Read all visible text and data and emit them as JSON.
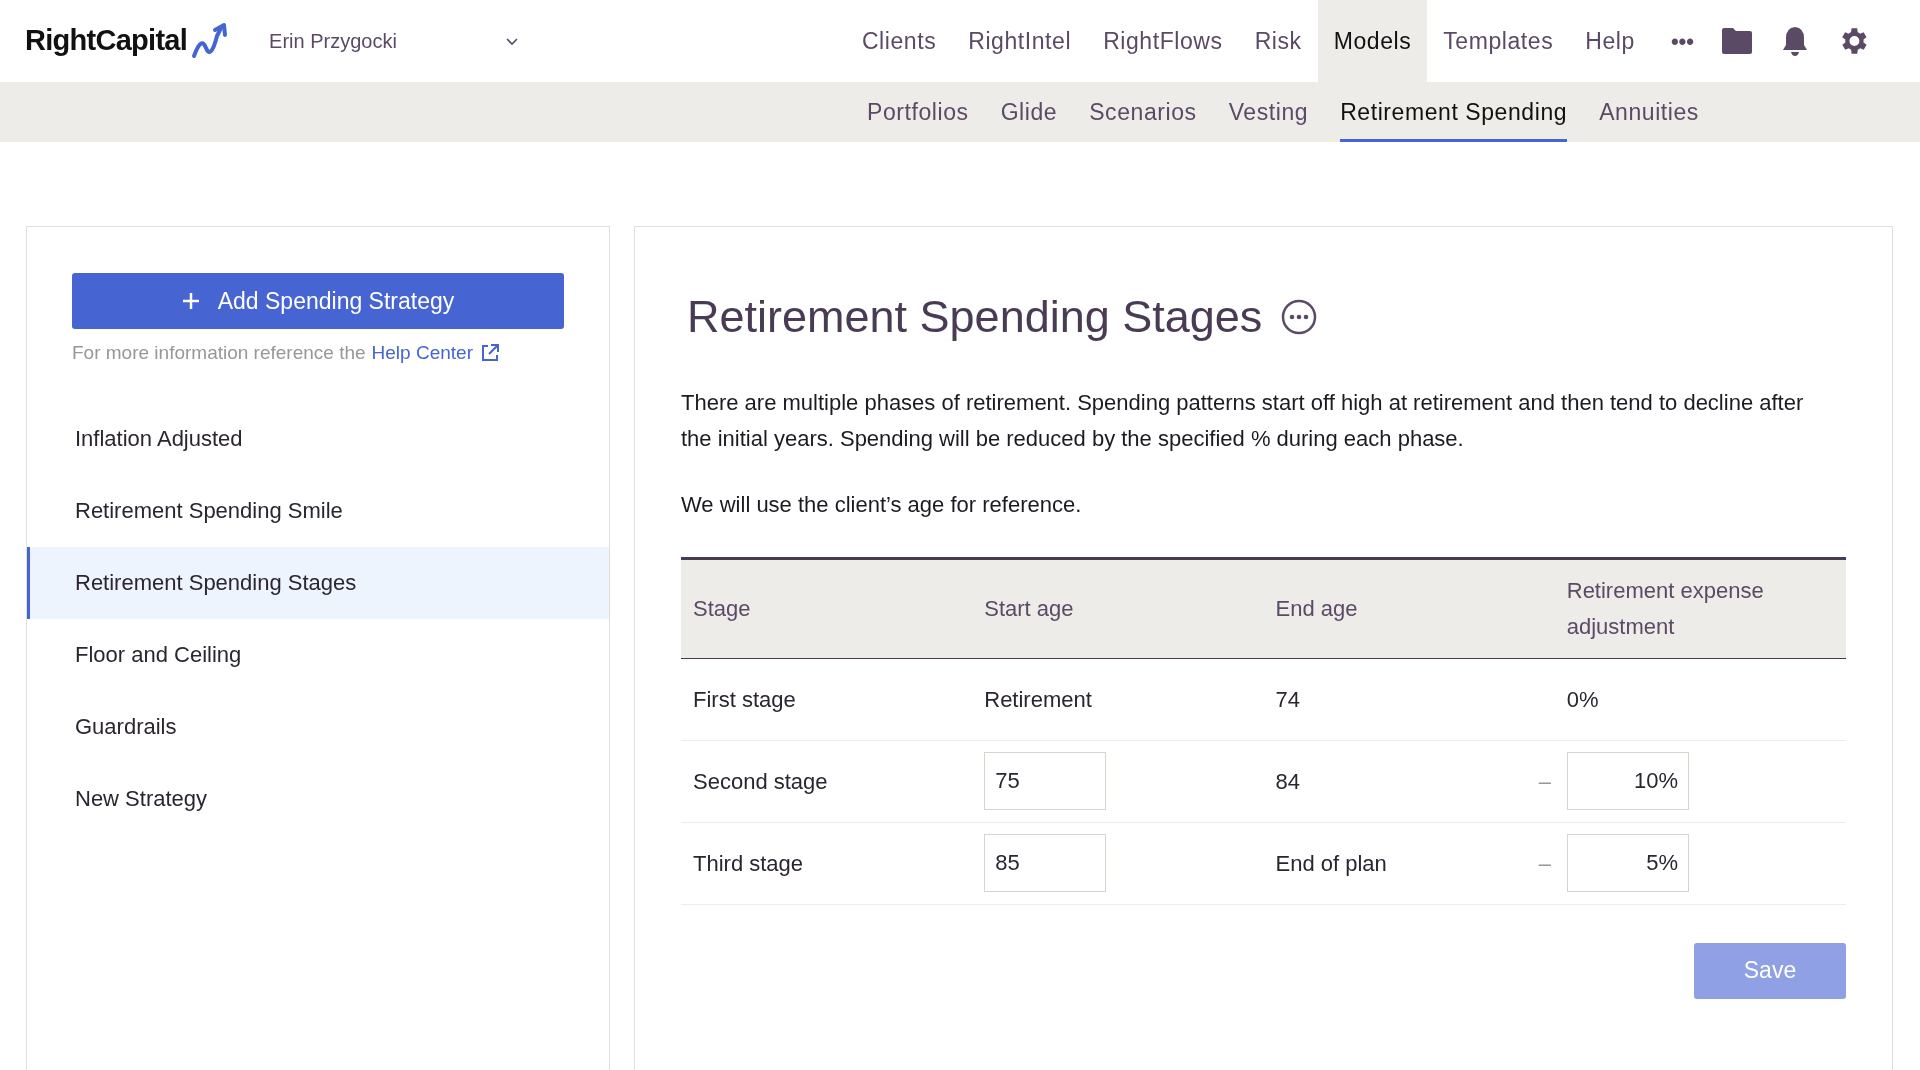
{
  "logo": {
    "text": "RightCapital"
  },
  "client_selector": {
    "value": "Erin Przygocki"
  },
  "nav": [
    {
      "label": "Clients",
      "selected": false
    },
    {
      "label": "RightIntel",
      "selected": false
    },
    {
      "label": "RightFlows",
      "selected": false
    },
    {
      "label": "Risk",
      "selected": false
    },
    {
      "label": "Models",
      "selected": true
    },
    {
      "label": "Templates",
      "selected": false
    },
    {
      "label": "Help",
      "selected": false
    }
  ],
  "more_menu": "•••",
  "subnav": [
    {
      "label": "Portfolios",
      "selected": false
    },
    {
      "label": "Glide",
      "selected": false
    },
    {
      "label": "Scenarios",
      "selected": false
    },
    {
      "label": "Vesting",
      "selected": false
    },
    {
      "label": "Retirement Spending",
      "selected": true
    },
    {
      "label": "Annuities",
      "selected": false
    }
  ],
  "sidebar": {
    "add_button": "Add Spending Strategy",
    "help_text": "For more information reference the",
    "help_link": "Help Center",
    "items": [
      {
        "label": "Inflation Adjusted",
        "selected": false
      },
      {
        "label": "Retirement Spending Smile",
        "selected": false
      },
      {
        "label": "Retirement Spending Stages",
        "selected": true
      },
      {
        "label": "Floor and Ceiling",
        "selected": false
      },
      {
        "label": "Guardrails",
        "selected": false
      },
      {
        "label": "New Strategy",
        "selected": false
      }
    ]
  },
  "main": {
    "title": "Retirement Spending Stages",
    "paragraphs": [
      "There are multiple phases of retirement. Spending patterns start off high at retirement and then tend to decline after the initial years. Spending will be reduced by the specified % during each phase.",
      "We will use the client’s age for reference."
    ],
    "table": {
      "columns": [
        "Stage",
        "Start age",
        "End age",
        "Retirement expense adjustment"
      ],
      "rows": [
        {
          "stage": "First stage",
          "start_age": {
            "kind": "text",
            "value": "Retirement"
          },
          "end_age": "74",
          "adjustment": {
            "kind": "text",
            "value": "0%"
          }
        },
        {
          "stage": "Second stage",
          "start_age": {
            "kind": "input",
            "value": "75"
          },
          "end_age": "84",
          "adjustment": {
            "kind": "input",
            "prefix": "–",
            "value": "10%"
          }
        },
        {
          "stage": "Third stage",
          "start_age": {
            "kind": "input",
            "value": "85"
          },
          "end_age": "End of plan",
          "adjustment": {
            "kind": "input",
            "prefix": "–",
            "value": "5%"
          }
        }
      ]
    },
    "save_button": {
      "label": "Save",
      "disabled": true
    }
  }
}
